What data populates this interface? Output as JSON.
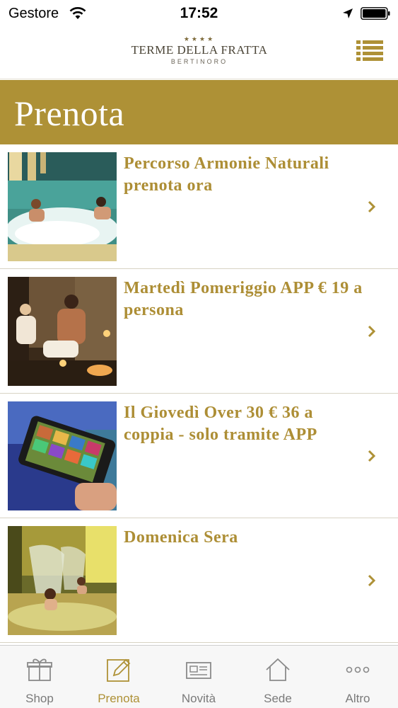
{
  "status_bar": {
    "carrier": "Gestore",
    "time": "17:52",
    "icons": [
      "wifi-icon",
      "location-arrow-icon",
      "battery-icon"
    ]
  },
  "header": {
    "logo": {
      "stars": "★★★★",
      "name": "TERME DELLA FRATTA",
      "city": "BERTINORO"
    },
    "menu_icon": "list-menu-icon"
  },
  "page": {
    "title": "Prenota"
  },
  "items": [
    {
      "label": "Percorso Armonie Naturali prenota ora",
      "image": "pool-couple-thumbnail"
    },
    {
      "label": "Martedì Pomeriggio APP € 19 a persona",
      "image": "sauna-candles-thumbnail"
    },
    {
      "label": "Il Giovedì Over 30 € 36 a coppia - solo tramite APP",
      "image": "smartphone-app-thumbnail"
    },
    {
      "label": "Domenica Sera",
      "image": "waterfall-pool-thumbnail"
    }
  ],
  "tabs": [
    {
      "label": "Shop",
      "icon": "gift-icon",
      "active": false
    },
    {
      "label": "Prenota",
      "icon": "edit-icon",
      "active": true
    },
    {
      "label": "Novità",
      "icon": "newspaper-icon",
      "active": false
    },
    {
      "label": "Sede",
      "icon": "home-icon",
      "active": false
    },
    {
      "label": "Altro",
      "icon": "more-icon",
      "active": false
    }
  ],
  "colors": {
    "accent": "#ae9136",
    "item_text": "#ad8e35",
    "tab_inactive": "#7a7a7a"
  }
}
